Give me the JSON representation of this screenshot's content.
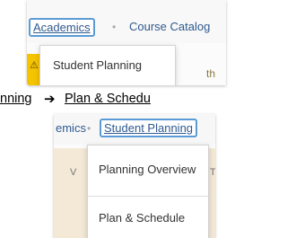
{
  "panel1": {
    "breadcrumb": {
      "active": "Academics",
      "separator": "•",
      "next": "Course Catalog"
    },
    "dropdown": {
      "items": [
        "Student Planning"
      ]
    },
    "warning_icon": "warning-triangle-icon",
    "peek_text": "th",
    "colors": {
      "accent_border": "#5b9bd5",
      "link": "#2f5a8f",
      "warning": "#f5c400"
    }
  },
  "instruction": {
    "left": "nning",
    "arrow": "➔",
    "right": "Plan & Schedu"
  },
  "panel2": {
    "breadcrumb": {
      "prev": "emics",
      "separator": "•",
      "active": "Student Planning"
    },
    "peek_left": "V",
    "peek_right": "T",
    "dropdown": {
      "items": [
        "Planning Overview",
        "Plan & Schedule"
      ]
    },
    "colors": {
      "background_tan": "#f3e9d6"
    }
  }
}
